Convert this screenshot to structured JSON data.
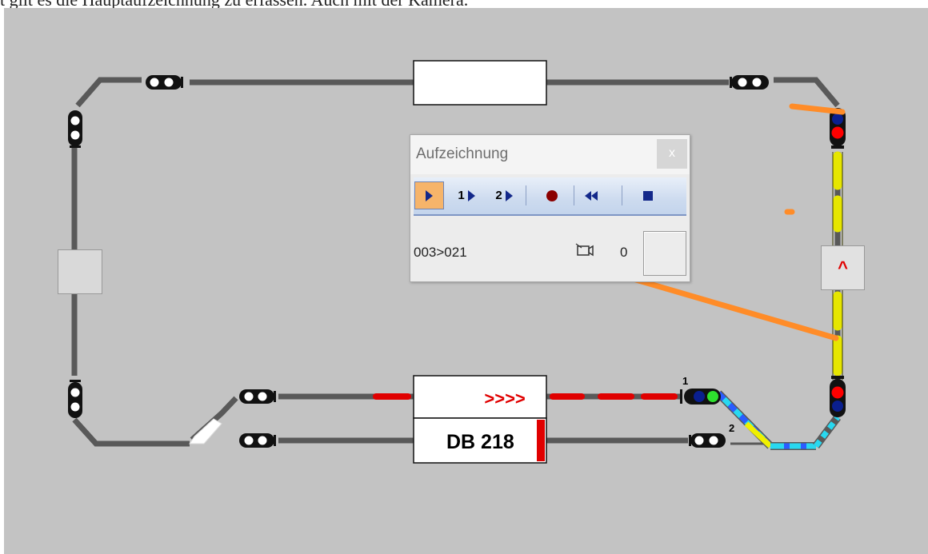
{
  "caption": "t gilt es die Hauptaufzeichnung zu erfassen. Auch mit der Kamera.",
  "recorder": {
    "title": "Aufzeichnung",
    "close": "x",
    "play1_label": "1",
    "play2_label": "2",
    "status": "003>021",
    "camera_icon": "camera-icon",
    "counter": "0"
  },
  "trains": {
    "upper_direction": ">>>>",
    "lower_name": "DB 218"
  },
  "track_labels": {
    "track1": "1",
    "track2": "2"
  },
  "signal_box_symbol": "^",
  "colors": {
    "background": "#c3c3c3",
    "track": "#6e6e6e",
    "occupied_red": "#e00000",
    "route_yellow": "#f0f000",
    "route_cyan": "#28d8f0",
    "annotation_orange": "#ff8c28"
  }
}
